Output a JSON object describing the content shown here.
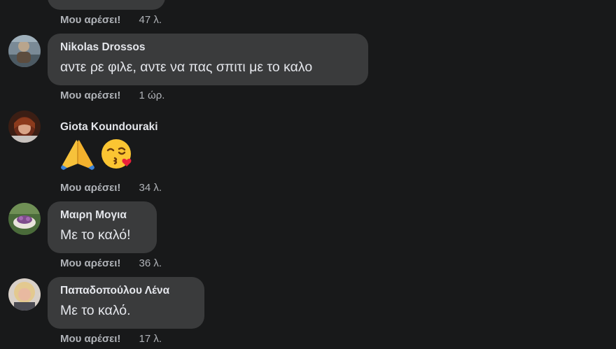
{
  "like_label": "Μου αρέσει!",
  "top_comment": {
    "time": "47 λ."
  },
  "comments": [
    {
      "author": "Nikolas Drossos",
      "text": "αντε ρε φιλε, αντε να πας σπιτι με το καλο",
      "time": "1 ώρ.",
      "avatar": "avatar-photo"
    },
    {
      "author": "Giota Koundouraki",
      "text": "",
      "emojis": [
        "folded-hands-emoji",
        "face-blowing-kiss-emoji"
      ],
      "time": "34 λ.",
      "avatar": "avatar-photo"
    },
    {
      "author": "Μαιρη Μογια",
      "text": "Με το καλό!",
      "time": "36 λ.",
      "avatar": "avatar-photo"
    },
    {
      "author": "Παπαδοπούλου Λένα",
      "text": "Με το καλό.",
      "time": "17 λ.",
      "avatar": "avatar-photo"
    }
  ],
  "colors": {
    "background": "#18191a",
    "bubble": "#3a3b3c",
    "primary_text": "#e4e6eb",
    "secondary_text": "#b0b3b8"
  }
}
